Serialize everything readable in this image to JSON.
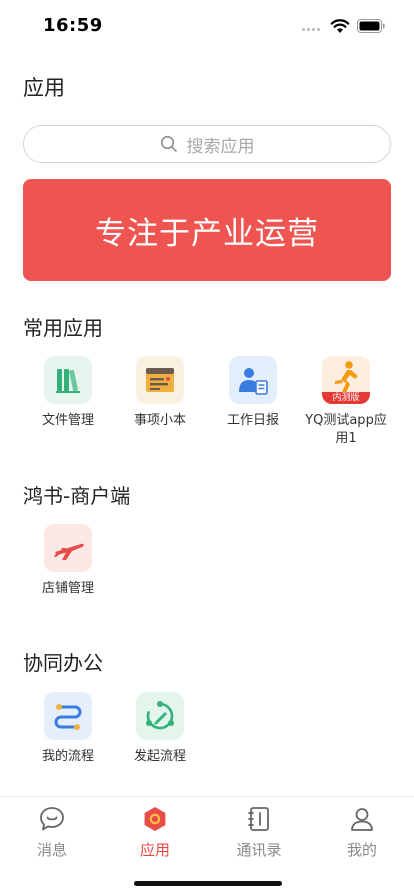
{
  "status_bar": {
    "time": "16:59"
  },
  "header": {
    "title": "应用"
  },
  "search": {
    "placeholder": "搜索应用"
  },
  "banner": {
    "text": "专注于产业运营",
    "color": "#ee5450"
  },
  "sections": [
    {
      "title": "常用应用",
      "apps": [
        {
          "label": "文件管理",
          "icon": "file-manager-icon"
        },
        {
          "label": "事项小本",
          "icon": "notebook-icon"
        },
        {
          "label": "工作日报",
          "icon": "daily-report-icon"
        },
        {
          "label": "YQ测试app应用1",
          "icon": "runner-icon",
          "badge": "内测版"
        }
      ]
    },
    {
      "title": "鸿书-商户端",
      "apps": [
        {
          "label": "店铺管理",
          "icon": "airplane-icon"
        }
      ]
    },
    {
      "title": "协同办公",
      "apps": [
        {
          "label": "我的流程",
          "icon": "workflow-icon"
        },
        {
          "label": "发起流程",
          "icon": "start-flow-icon"
        }
      ]
    }
  ],
  "tabbar": {
    "active_color": "#e94b47",
    "tabs": [
      {
        "label": "消息",
        "icon": "message-icon",
        "active": false
      },
      {
        "label": "应用",
        "icon": "apps-icon",
        "active": true
      },
      {
        "label": "通讯录",
        "icon": "contacts-icon",
        "active": false
      },
      {
        "label": "我的",
        "icon": "profile-icon",
        "active": false
      }
    ]
  }
}
